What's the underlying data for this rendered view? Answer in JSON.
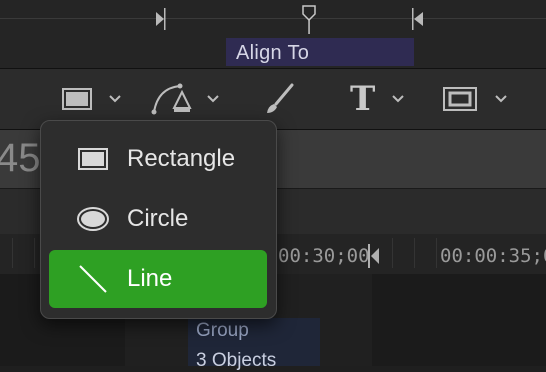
{
  "timeline_top": {
    "align_label": "Align To"
  },
  "toolbar": {
    "shape_icon": "rectangle-icon",
    "pen_icon": "pen-icon",
    "brush_icon": "paintbrush-icon",
    "text_tool_glyph": "T",
    "mask_icon": "mask-icon"
  },
  "header": {
    "big_number": "45"
  },
  "ruler": {
    "timecode_1": "00:30;00",
    "timecode_2": "00:00:35;0"
  },
  "track": {
    "group_label": "Group",
    "objects_label": "3 Objects"
  },
  "shape_menu": {
    "items": [
      {
        "label": "Rectangle",
        "icon": "rectangle-icon"
      },
      {
        "label": "Circle",
        "icon": "circle-icon"
      },
      {
        "label": "Line",
        "icon": "line-icon",
        "selected": true
      }
    ],
    "selected_color": "#2ea023"
  }
}
